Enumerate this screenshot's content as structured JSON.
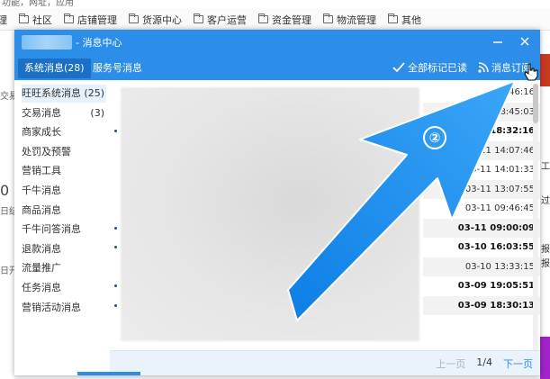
{
  "background": {
    "top_fragment": "功能，网址，应用",
    "nav_items": [
      "管理",
      "社区",
      "店铺管理",
      "货源中心",
      "客户运营",
      "资金管理",
      "物流管理",
      "其他"
    ],
    "left_fragments": [
      "交易",
      "0",
      "日结",
      "日开"
    ],
    "right_fragments": [
      "过",
      "工",
      "报",
      "报"
    ]
  },
  "dialog": {
    "title": "- 消息中心",
    "tabs": [
      "系统消息(28)",
      "服务号消息"
    ],
    "actions": {
      "mark_all_read": "全部标记已读",
      "subscribe": "消息订阅"
    },
    "categories": [
      {
        "label": "旺旺系统消息",
        "count": "(25)"
      },
      {
        "label": "交易消息",
        "count": "(3)"
      },
      {
        "label": "商家成长",
        "count": ""
      },
      {
        "label": "处罚及预警",
        "count": ""
      },
      {
        "label": "营销工具",
        "count": ""
      },
      {
        "label": "千牛消息",
        "count": ""
      },
      {
        "label": "商品消息",
        "count": ""
      },
      {
        "label": "千牛问答消息",
        "count": ""
      },
      {
        "label": "退款消息",
        "count": ""
      },
      {
        "label": "流量推广",
        "count": ""
      },
      {
        "label": "任务消息",
        "count": ""
      },
      {
        "label": "营销活动消息",
        "count": ""
      }
    ],
    "messages": [
      {
        "time": "08:46:16",
        "bold": false,
        "dot": false
      },
      {
        "time": "12 08:45:03",
        "bold": false,
        "dot": false
      },
      {
        "time": "03-11 18:32:16",
        "bold": true,
        "dot": true
      },
      {
        "time": "03-11 14:07:46",
        "bold": false,
        "dot": false
      },
      {
        "time": "03-11 14:01:33",
        "bold": false,
        "dot": false
      },
      {
        "time": "03-11 13:07:55",
        "bold": false,
        "dot": false
      },
      {
        "time": "03-11 09:46:45",
        "bold": false,
        "dot": false
      },
      {
        "time": "03-11 09:00:09",
        "bold": true,
        "dot": true
      },
      {
        "time": "03-10 16:03:55",
        "bold": true,
        "dot": true
      },
      {
        "time": "03-10 13:33:15",
        "bold": false,
        "dot": false
      },
      {
        "time": "03-09 19:05:51",
        "bold": true,
        "dot": true
      },
      {
        "time": "03-09 18:30:13",
        "bold": true,
        "dot": true
      }
    ],
    "pager": {
      "prev": "上一页",
      "page": "1/4",
      "next": "下一页"
    }
  },
  "annotation": {
    "step": "②"
  },
  "colors": {
    "primary": "#2c8ee8",
    "arrow": "#1a8fef"
  }
}
